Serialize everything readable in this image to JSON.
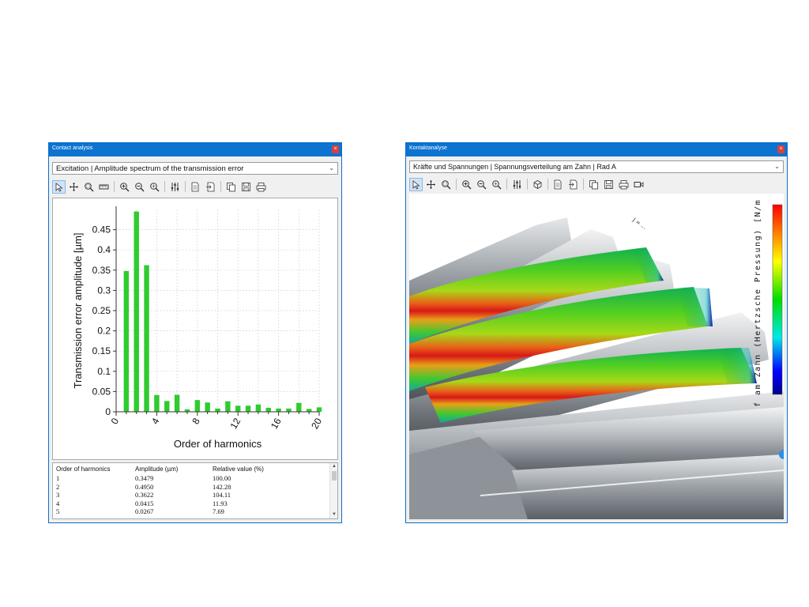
{
  "left_window": {
    "title": "Contact analysis",
    "close_glyph": "×",
    "dropdown_value": "Excitation | Amplitude spectrum of the transmission error",
    "toolbar_icons": [
      "pointer-icon",
      "pan-icon",
      "zoom-window-icon",
      "measure-icon",
      "zoom-in-icon",
      "zoom-out-icon",
      "zoom-fit-icon",
      "settings-icon",
      "export-icon",
      "import-icon",
      "copy-icon",
      "save-icon",
      "print-icon"
    ],
    "table": {
      "headers": [
        "Order of harmonics",
        "Amplitude (µm)",
        "Relative value (%)"
      ],
      "rows": [
        [
          "1",
          "0.3479",
          "100.00"
        ],
        [
          "2",
          "0.4950",
          "142.28"
        ],
        [
          "3",
          "0.3622",
          "104.11"
        ],
        [
          "4",
          "0.0415",
          "11.93"
        ],
        [
          "5",
          "0.0267",
          "7.69"
        ]
      ]
    }
  },
  "chart_data": {
    "type": "bar",
    "xlabel": "Order of harmonics",
    "ylabel": "Transmission error amplitude [µm]",
    "x": [
      1,
      2,
      3,
      4,
      5,
      6,
      7,
      8,
      9,
      10,
      11,
      12,
      13,
      14,
      15,
      16,
      17,
      18,
      19,
      20
    ],
    "values": [
      0.3479,
      0.495,
      0.3622,
      0.0415,
      0.0267,
      0.042,
      0.006,
      0.029,
      0.023,
      0.008,
      0.026,
      0.015,
      0.015,
      0.018,
      0.01,
      0.008,
      0.008,
      0.022,
      0.007,
      0.011
    ],
    "xlim": [
      0,
      20
    ],
    "ylim": [
      0,
      0.5
    ],
    "xticks": [
      0,
      4,
      8,
      12,
      16,
      20
    ],
    "yticks": [
      0,
      0.05,
      0.1,
      0.15,
      0.2,
      0.25,
      0.3,
      0.35,
      0.4,
      0.45
    ],
    "grid": true,
    "bar_color": "#2ecc2e"
  },
  "right_window": {
    "title": "Kontaktanalyse",
    "close_glyph": "×",
    "dropdown_value": "Kräfte und Spannungen | Spannungsverteilung am Zahn | Rad A",
    "toolbar_icons": [
      "pointer-icon",
      "pan-icon",
      "zoom-window-icon",
      "zoom-in-icon",
      "zoom-out-icon",
      "zoom-fit-icon",
      "settings-icon",
      "view-cube-icon",
      "export-icon",
      "import-icon",
      "copy-icon",
      "save-icon",
      "print-icon",
      "video-icon"
    ],
    "legend_label": "f am Zahn (Hertzsche Pressung) [N/m",
    "colormap": [
      "#00008b",
      "#0000ff",
      "#00ffff",
      "#00ff00",
      "#ffff00",
      "#ff8000",
      "#ff0000"
    ],
    "axis_label": "J = ..."
  }
}
